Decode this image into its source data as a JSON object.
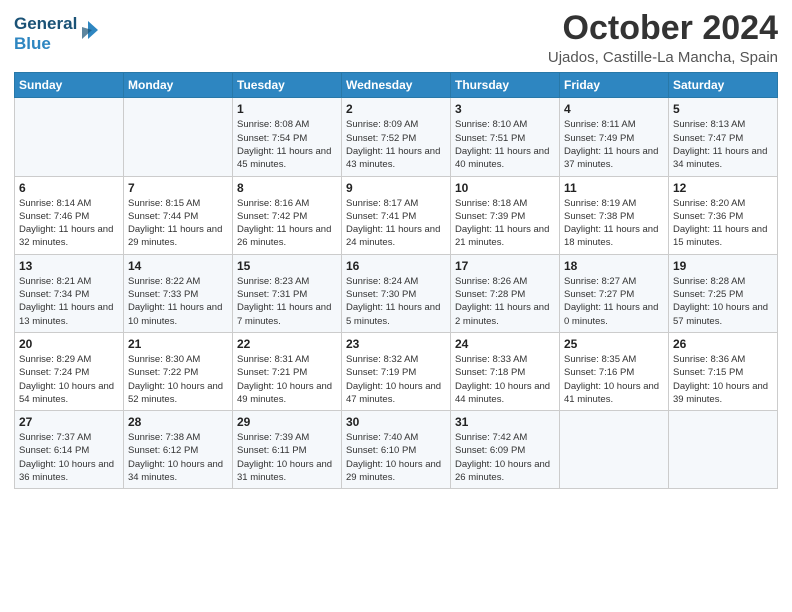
{
  "header": {
    "logo_line1": "General",
    "logo_line2": "Blue",
    "month": "October 2024",
    "location": "Ujados, Castille-La Mancha, Spain"
  },
  "weekdays": [
    "Sunday",
    "Monday",
    "Tuesday",
    "Wednesday",
    "Thursday",
    "Friday",
    "Saturday"
  ],
  "weeks": [
    [
      {
        "day": "",
        "sunrise": "",
        "sunset": "",
        "daylight": ""
      },
      {
        "day": "",
        "sunrise": "",
        "sunset": "",
        "daylight": ""
      },
      {
        "day": "1",
        "sunrise": "Sunrise: 8:08 AM",
        "sunset": "Sunset: 7:54 PM",
        "daylight": "Daylight: 11 hours and 45 minutes."
      },
      {
        "day": "2",
        "sunrise": "Sunrise: 8:09 AM",
        "sunset": "Sunset: 7:52 PM",
        "daylight": "Daylight: 11 hours and 43 minutes."
      },
      {
        "day": "3",
        "sunrise": "Sunrise: 8:10 AM",
        "sunset": "Sunset: 7:51 PM",
        "daylight": "Daylight: 11 hours and 40 minutes."
      },
      {
        "day": "4",
        "sunrise": "Sunrise: 8:11 AM",
        "sunset": "Sunset: 7:49 PM",
        "daylight": "Daylight: 11 hours and 37 minutes."
      },
      {
        "day": "5",
        "sunrise": "Sunrise: 8:13 AM",
        "sunset": "Sunset: 7:47 PM",
        "daylight": "Daylight: 11 hours and 34 minutes."
      }
    ],
    [
      {
        "day": "6",
        "sunrise": "Sunrise: 8:14 AM",
        "sunset": "Sunset: 7:46 PM",
        "daylight": "Daylight: 11 hours and 32 minutes."
      },
      {
        "day": "7",
        "sunrise": "Sunrise: 8:15 AM",
        "sunset": "Sunset: 7:44 PM",
        "daylight": "Daylight: 11 hours and 29 minutes."
      },
      {
        "day": "8",
        "sunrise": "Sunrise: 8:16 AM",
        "sunset": "Sunset: 7:42 PM",
        "daylight": "Daylight: 11 hours and 26 minutes."
      },
      {
        "day": "9",
        "sunrise": "Sunrise: 8:17 AM",
        "sunset": "Sunset: 7:41 PM",
        "daylight": "Daylight: 11 hours and 24 minutes."
      },
      {
        "day": "10",
        "sunrise": "Sunrise: 8:18 AM",
        "sunset": "Sunset: 7:39 PM",
        "daylight": "Daylight: 11 hours and 21 minutes."
      },
      {
        "day": "11",
        "sunrise": "Sunrise: 8:19 AM",
        "sunset": "Sunset: 7:38 PM",
        "daylight": "Daylight: 11 hours and 18 minutes."
      },
      {
        "day": "12",
        "sunrise": "Sunrise: 8:20 AM",
        "sunset": "Sunset: 7:36 PM",
        "daylight": "Daylight: 11 hours and 15 minutes."
      }
    ],
    [
      {
        "day": "13",
        "sunrise": "Sunrise: 8:21 AM",
        "sunset": "Sunset: 7:34 PM",
        "daylight": "Daylight: 11 hours and 13 minutes."
      },
      {
        "day": "14",
        "sunrise": "Sunrise: 8:22 AM",
        "sunset": "Sunset: 7:33 PM",
        "daylight": "Daylight: 11 hours and 10 minutes."
      },
      {
        "day": "15",
        "sunrise": "Sunrise: 8:23 AM",
        "sunset": "Sunset: 7:31 PM",
        "daylight": "Daylight: 11 hours and 7 minutes."
      },
      {
        "day": "16",
        "sunrise": "Sunrise: 8:24 AM",
        "sunset": "Sunset: 7:30 PM",
        "daylight": "Daylight: 11 hours and 5 minutes."
      },
      {
        "day": "17",
        "sunrise": "Sunrise: 8:26 AM",
        "sunset": "Sunset: 7:28 PM",
        "daylight": "Daylight: 11 hours and 2 minutes."
      },
      {
        "day": "18",
        "sunrise": "Sunrise: 8:27 AM",
        "sunset": "Sunset: 7:27 PM",
        "daylight": "Daylight: 11 hours and 0 minutes."
      },
      {
        "day": "19",
        "sunrise": "Sunrise: 8:28 AM",
        "sunset": "Sunset: 7:25 PM",
        "daylight": "Daylight: 10 hours and 57 minutes."
      }
    ],
    [
      {
        "day": "20",
        "sunrise": "Sunrise: 8:29 AM",
        "sunset": "Sunset: 7:24 PM",
        "daylight": "Daylight: 10 hours and 54 minutes."
      },
      {
        "day": "21",
        "sunrise": "Sunrise: 8:30 AM",
        "sunset": "Sunset: 7:22 PM",
        "daylight": "Daylight: 10 hours and 52 minutes."
      },
      {
        "day": "22",
        "sunrise": "Sunrise: 8:31 AM",
        "sunset": "Sunset: 7:21 PM",
        "daylight": "Daylight: 10 hours and 49 minutes."
      },
      {
        "day": "23",
        "sunrise": "Sunrise: 8:32 AM",
        "sunset": "Sunset: 7:19 PM",
        "daylight": "Daylight: 10 hours and 47 minutes."
      },
      {
        "day": "24",
        "sunrise": "Sunrise: 8:33 AM",
        "sunset": "Sunset: 7:18 PM",
        "daylight": "Daylight: 10 hours and 44 minutes."
      },
      {
        "day": "25",
        "sunrise": "Sunrise: 8:35 AM",
        "sunset": "Sunset: 7:16 PM",
        "daylight": "Daylight: 10 hours and 41 minutes."
      },
      {
        "day": "26",
        "sunrise": "Sunrise: 8:36 AM",
        "sunset": "Sunset: 7:15 PM",
        "daylight": "Daylight: 10 hours and 39 minutes."
      }
    ],
    [
      {
        "day": "27",
        "sunrise": "Sunrise: 7:37 AM",
        "sunset": "Sunset: 6:14 PM",
        "daylight": "Daylight: 10 hours and 36 minutes."
      },
      {
        "day": "28",
        "sunrise": "Sunrise: 7:38 AM",
        "sunset": "Sunset: 6:12 PM",
        "daylight": "Daylight: 10 hours and 34 minutes."
      },
      {
        "day": "29",
        "sunrise": "Sunrise: 7:39 AM",
        "sunset": "Sunset: 6:11 PM",
        "daylight": "Daylight: 10 hours and 31 minutes."
      },
      {
        "day": "30",
        "sunrise": "Sunrise: 7:40 AM",
        "sunset": "Sunset: 6:10 PM",
        "daylight": "Daylight: 10 hours and 29 minutes."
      },
      {
        "day": "31",
        "sunrise": "Sunrise: 7:42 AM",
        "sunset": "Sunset: 6:09 PM",
        "daylight": "Daylight: 10 hours and 26 minutes."
      },
      {
        "day": "",
        "sunrise": "",
        "sunset": "",
        "daylight": ""
      },
      {
        "day": "",
        "sunrise": "",
        "sunset": "",
        "daylight": ""
      }
    ]
  ]
}
